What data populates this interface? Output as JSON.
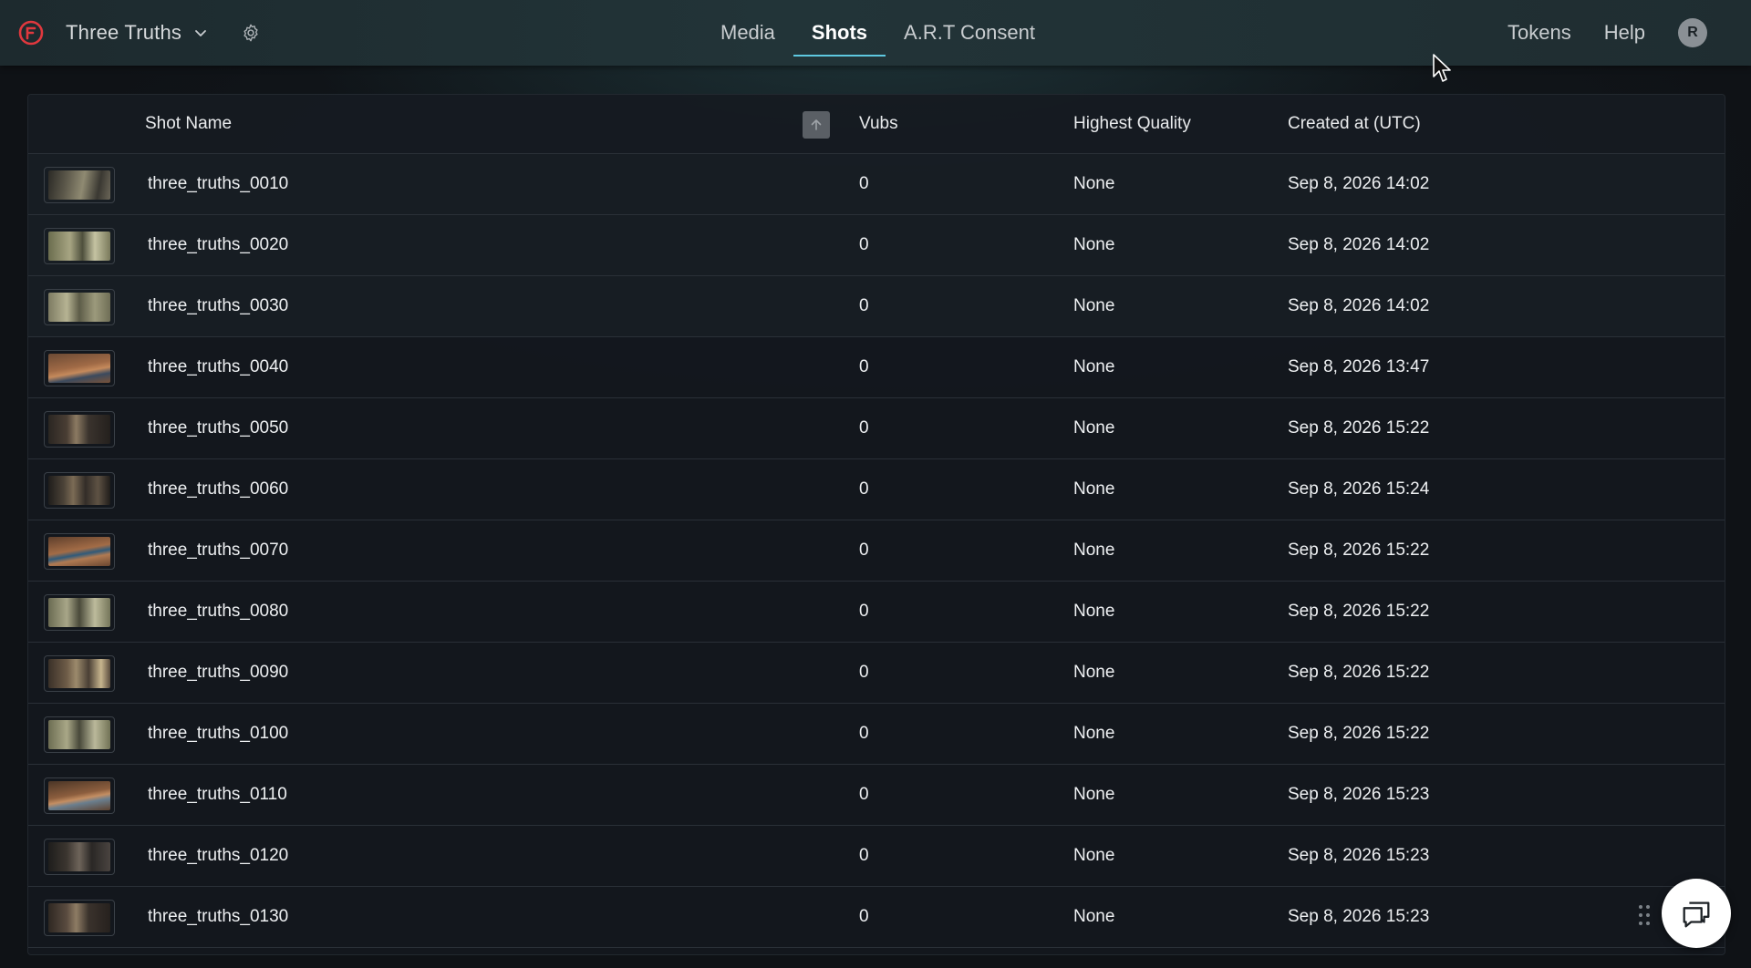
{
  "header": {
    "project_name": "Three Truths",
    "tabs": [
      {
        "label": "Media",
        "active": false
      },
      {
        "label": "Shots",
        "active": true
      },
      {
        "label": "A.R.T Consent",
        "active": false
      }
    ],
    "tokens_label": "Tokens",
    "help_label": "Help",
    "avatar_initial": "R"
  },
  "colors": {
    "accent": "#5ec8e0",
    "logo": "#e0383e"
  },
  "table": {
    "columns": {
      "shot_name": "Shot Name",
      "vubs": "Vubs",
      "highest_quality": "Highest Quality",
      "created_at": "Created at (UTC)"
    },
    "rows": [
      {
        "name": "three_truths_0010",
        "vubs": "0",
        "quality": "None",
        "created": "Sep 8, 2026 14:02"
      },
      {
        "name": "three_truths_0020",
        "vubs": "0",
        "quality": "None",
        "created": "Sep 8, 2026 14:02"
      },
      {
        "name": "three_truths_0030",
        "vubs": "0",
        "quality": "None",
        "created": "Sep 8, 2026 14:02"
      },
      {
        "name": "three_truths_0040",
        "vubs": "0",
        "quality": "None",
        "created": "Sep 8, 2026 13:47"
      },
      {
        "name": "three_truths_0050",
        "vubs": "0",
        "quality": "None",
        "created": "Sep 8, 2026 15:22"
      },
      {
        "name": "three_truths_0060",
        "vubs": "0",
        "quality": "None",
        "created": "Sep 8, 2026 15:24"
      },
      {
        "name": "three_truths_0070",
        "vubs": "0",
        "quality": "None",
        "created": "Sep 8, 2026 15:22"
      },
      {
        "name": "three_truths_0080",
        "vubs": "0",
        "quality": "None",
        "created": "Sep 8, 2026 15:22"
      },
      {
        "name": "three_truths_0090",
        "vubs": "0",
        "quality": "None",
        "created": "Sep 8, 2026 15:22"
      },
      {
        "name": "three_truths_0100",
        "vubs": "0",
        "quality": "None",
        "created": "Sep 8, 2026 15:22"
      },
      {
        "name": "three_truths_0110",
        "vubs": "0",
        "quality": "None",
        "created": "Sep 8, 2026 15:23"
      },
      {
        "name": "three_truths_0120",
        "vubs": "0",
        "quality": "None",
        "created": "Sep 8, 2026 15:23"
      },
      {
        "name": "three_truths_0130",
        "vubs": "0",
        "quality": "None",
        "created": "Sep 8, 2026 15:23"
      }
    ]
  }
}
